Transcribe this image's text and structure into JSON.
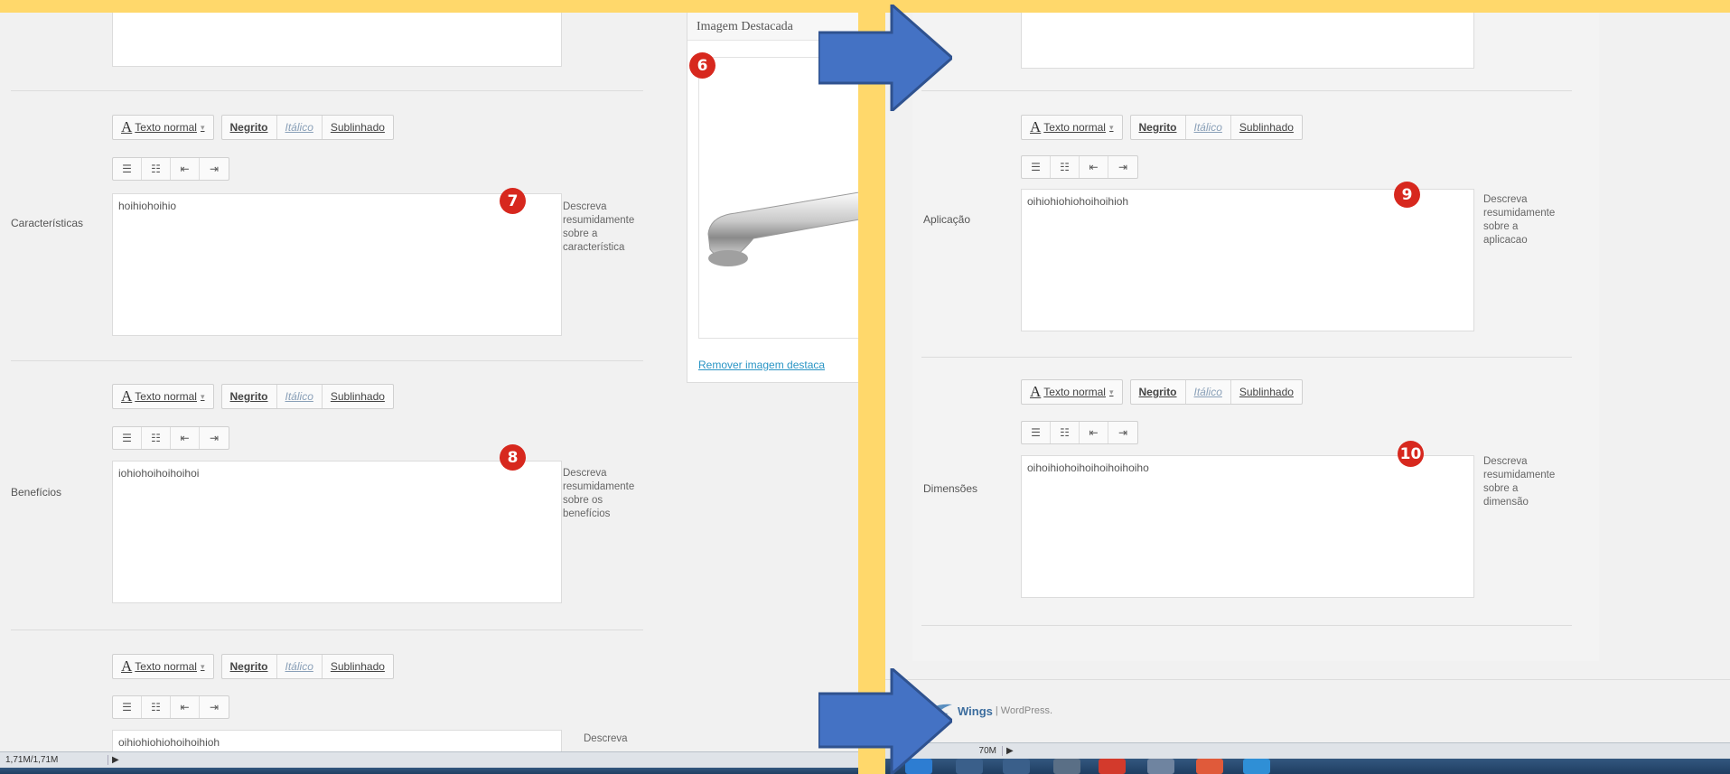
{
  "colors": {
    "background_frame": "#ffd86b",
    "panel": "#f1f1f1",
    "badge": "#d7281e",
    "arrow_fill": "#4472c4",
    "link": "#2a95c5",
    "taskbar": "#2a4a70"
  },
  "toolbar": {
    "font_style_label": "Texto normal",
    "bold_label": "Negrito",
    "italic_label": "Itálico",
    "underline_label": "Sublinhado",
    "icons": [
      "unordered-list-icon",
      "ordered-list-icon",
      "outdent-icon",
      "indent-icon"
    ],
    "icon_glyphs": [
      "☰",
      "☷",
      "⇤",
      "⇥"
    ]
  },
  "left": {
    "fields": [
      {
        "label": "Características",
        "value": "hoihiohoihio",
        "desc": [
          "Descreva",
          "resumidamente",
          "sobre a",
          "característica"
        ],
        "badge": "7"
      },
      {
        "label": "Benefícios",
        "value": "iohiohoihoihoihoi",
        "desc": [
          "Descreva",
          "resumidamente",
          "sobre os",
          "benefícios"
        ],
        "badge": "8"
      },
      {
        "label": "",
        "value": "oihiohiohiohoihoihioh",
        "desc": [
          "Descreva"
        ],
        "badge": ""
      }
    ],
    "featured_image": {
      "title": "Imagem Destacada",
      "badge": "6",
      "remove_link": "Remover imagem destaca"
    },
    "status_text": "1,71M/1,71M"
  },
  "right": {
    "fields": [
      {
        "label": "Aplicação",
        "value": "oihiohiohiohoihoihioh",
        "desc": [
          "Descreva",
          "resumidamente",
          "sobre a",
          "aplicacao"
        ],
        "badge": "9"
      },
      {
        "label": "Dimensões",
        "value": "oihoihiohoihoihoihoihoiho",
        "desc": [
          "Descreva",
          "resumidamente",
          "sobre a",
          "dimensão"
        ],
        "badge": "10"
      }
    ],
    "footer_brand": "Wings",
    "footer_suffix": "| WordPress.",
    "status_text": "70M"
  }
}
